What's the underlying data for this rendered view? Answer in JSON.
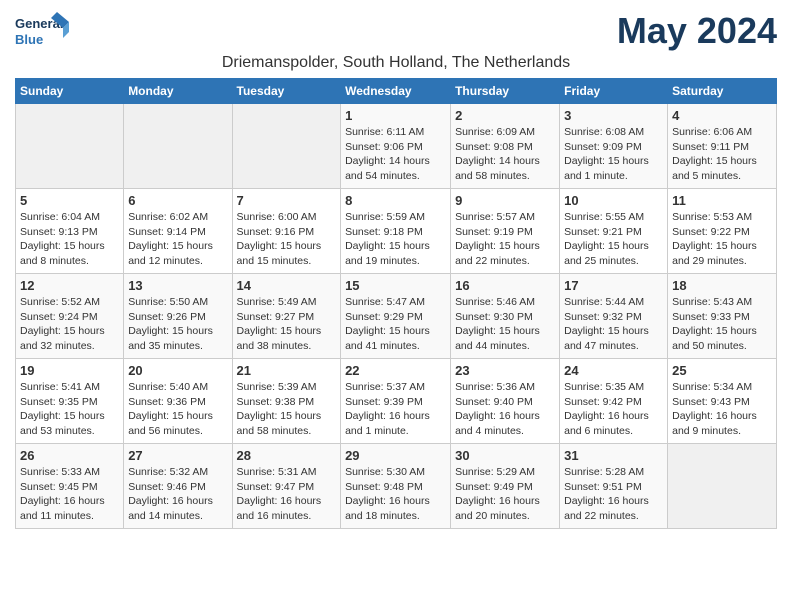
{
  "logo": {
    "line1": "General",
    "line2": "Blue"
  },
  "header": {
    "month_year": "May 2024",
    "location": "Driemanspolder, South Holland, The Netherlands"
  },
  "days_of_week": [
    "Sunday",
    "Monday",
    "Tuesday",
    "Wednesday",
    "Thursday",
    "Friday",
    "Saturday"
  ],
  "weeks": [
    [
      {
        "num": "",
        "info": ""
      },
      {
        "num": "",
        "info": ""
      },
      {
        "num": "",
        "info": ""
      },
      {
        "num": "1",
        "info": "Sunrise: 6:11 AM\nSunset: 9:06 PM\nDaylight: 14 hours\nand 54 minutes."
      },
      {
        "num": "2",
        "info": "Sunrise: 6:09 AM\nSunset: 9:08 PM\nDaylight: 14 hours\nand 58 minutes."
      },
      {
        "num": "3",
        "info": "Sunrise: 6:08 AM\nSunset: 9:09 PM\nDaylight: 15 hours\nand 1 minute."
      },
      {
        "num": "4",
        "info": "Sunrise: 6:06 AM\nSunset: 9:11 PM\nDaylight: 15 hours\nand 5 minutes."
      }
    ],
    [
      {
        "num": "5",
        "info": "Sunrise: 6:04 AM\nSunset: 9:13 PM\nDaylight: 15 hours\nand 8 minutes."
      },
      {
        "num": "6",
        "info": "Sunrise: 6:02 AM\nSunset: 9:14 PM\nDaylight: 15 hours\nand 12 minutes."
      },
      {
        "num": "7",
        "info": "Sunrise: 6:00 AM\nSunset: 9:16 PM\nDaylight: 15 hours\nand 15 minutes."
      },
      {
        "num": "8",
        "info": "Sunrise: 5:59 AM\nSunset: 9:18 PM\nDaylight: 15 hours\nand 19 minutes."
      },
      {
        "num": "9",
        "info": "Sunrise: 5:57 AM\nSunset: 9:19 PM\nDaylight: 15 hours\nand 22 minutes."
      },
      {
        "num": "10",
        "info": "Sunrise: 5:55 AM\nSunset: 9:21 PM\nDaylight: 15 hours\nand 25 minutes."
      },
      {
        "num": "11",
        "info": "Sunrise: 5:53 AM\nSunset: 9:22 PM\nDaylight: 15 hours\nand 29 minutes."
      }
    ],
    [
      {
        "num": "12",
        "info": "Sunrise: 5:52 AM\nSunset: 9:24 PM\nDaylight: 15 hours\nand 32 minutes."
      },
      {
        "num": "13",
        "info": "Sunrise: 5:50 AM\nSunset: 9:26 PM\nDaylight: 15 hours\nand 35 minutes."
      },
      {
        "num": "14",
        "info": "Sunrise: 5:49 AM\nSunset: 9:27 PM\nDaylight: 15 hours\nand 38 minutes."
      },
      {
        "num": "15",
        "info": "Sunrise: 5:47 AM\nSunset: 9:29 PM\nDaylight: 15 hours\nand 41 minutes."
      },
      {
        "num": "16",
        "info": "Sunrise: 5:46 AM\nSunset: 9:30 PM\nDaylight: 15 hours\nand 44 minutes."
      },
      {
        "num": "17",
        "info": "Sunrise: 5:44 AM\nSunset: 9:32 PM\nDaylight: 15 hours\nand 47 minutes."
      },
      {
        "num": "18",
        "info": "Sunrise: 5:43 AM\nSunset: 9:33 PM\nDaylight: 15 hours\nand 50 minutes."
      }
    ],
    [
      {
        "num": "19",
        "info": "Sunrise: 5:41 AM\nSunset: 9:35 PM\nDaylight: 15 hours\nand 53 minutes."
      },
      {
        "num": "20",
        "info": "Sunrise: 5:40 AM\nSunset: 9:36 PM\nDaylight: 15 hours\nand 56 minutes."
      },
      {
        "num": "21",
        "info": "Sunrise: 5:39 AM\nSunset: 9:38 PM\nDaylight: 15 hours\nand 58 minutes."
      },
      {
        "num": "22",
        "info": "Sunrise: 5:37 AM\nSunset: 9:39 PM\nDaylight: 16 hours\nand 1 minute."
      },
      {
        "num": "23",
        "info": "Sunrise: 5:36 AM\nSunset: 9:40 PM\nDaylight: 16 hours\nand 4 minutes."
      },
      {
        "num": "24",
        "info": "Sunrise: 5:35 AM\nSunset: 9:42 PM\nDaylight: 16 hours\nand 6 minutes."
      },
      {
        "num": "25",
        "info": "Sunrise: 5:34 AM\nSunset: 9:43 PM\nDaylight: 16 hours\nand 9 minutes."
      }
    ],
    [
      {
        "num": "26",
        "info": "Sunrise: 5:33 AM\nSunset: 9:45 PM\nDaylight: 16 hours\nand 11 minutes."
      },
      {
        "num": "27",
        "info": "Sunrise: 5:32 AM\nSunset: 9:46 PM\nDaylight: 16 hours\nand 14 minutes."
      },
      {
        "num": "28",
        "info": "Sunrise: 5:31 AM\nSunset: 9:47 PM\nDaylight: 16 hours\nand 16 minutes."
      },
      {
        "num": "29",
        "info": "Sunrise: 5:30 AM\nSunset: 9:48 PM\nDaylight: 16 hours\nand 18 minutes."
      },
      {
        "num": "30",
        "info": "Sunrise: 5:29 AM\nSunset: 9:49 PM\nDaylight: 16 hours\nand 20 minutes."
      },
      {
        "num": "31",
        "info": "Sunrise: 5:28 AM\nSunset: 9:51 PM\nDaylight: 16 hours\nand 22 minutes."
      },
      {
        "num": "",
        "info": ""
      }
    ]
  ]
}
